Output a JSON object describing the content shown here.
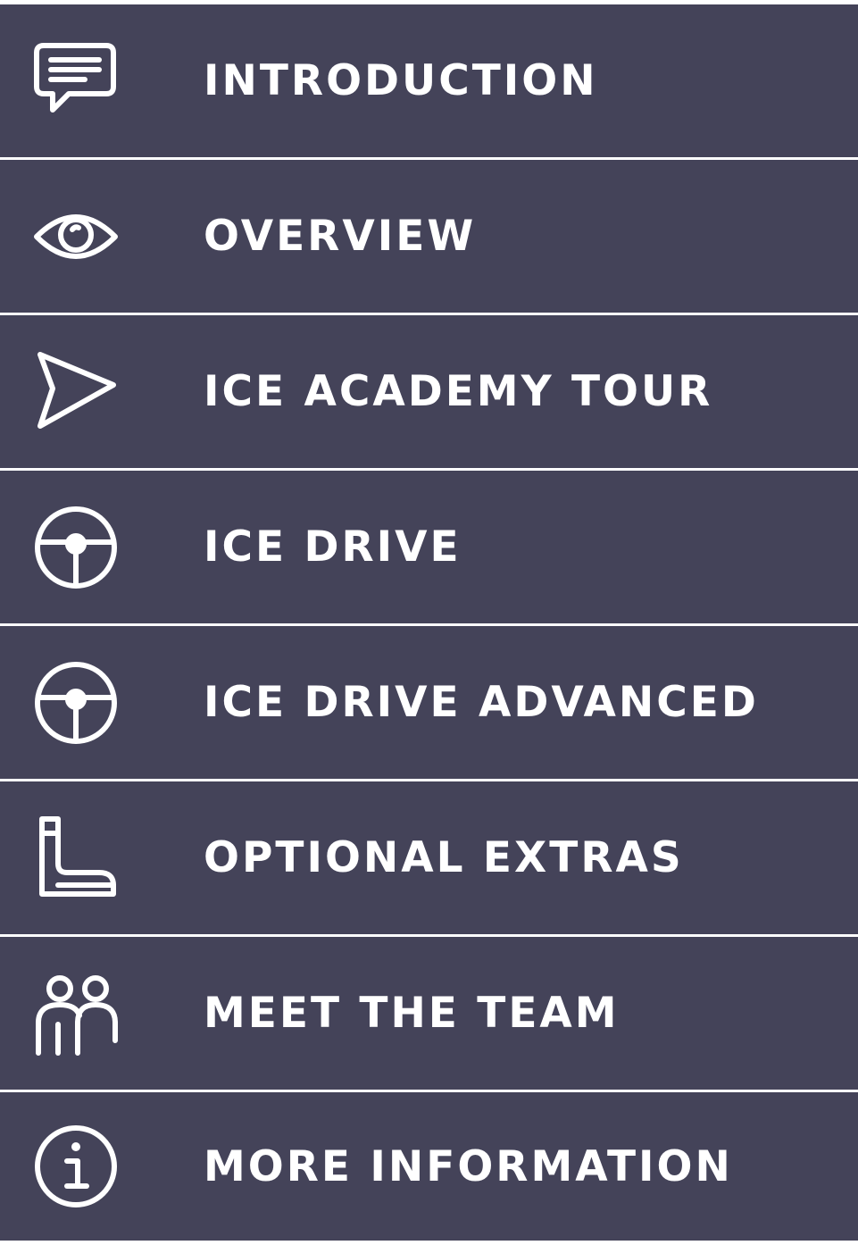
{
  "colors": {
    "item_background": "#444359",
    "separator": "#ffffff",
    "text": "#ffffff"
  },
  "menu": {
    "items": [
      {
        "label": "INTRODUCTION",
        "icon": "speech-bubble-icon"
      },
      {
        "label": "OVERVIEW",
        "icon": "eye-icon"
      },
      {
        "label": "ICE ACADEMY TOUR",
        "icon": "navigation-arrow-icon"
      },
      {
        "label": "ICE DRIVE",
        "icon": "steering-wheel-icon"
      },
      {
        "label": "ICE DRIVE ADVANCED",
        "icon": "steering-wheel-icon"
      },
      {
        "label": "OPTIONAL EXTRAS",
        "icon": "boot-icon"
      },
      {
        "label": "MEET THE TEAM",
        "icon": "people-icon"
      },
      {
        "label": "MORE INFORMATION",
        "icon": "info-icon"
      }
    ]
  }
}
